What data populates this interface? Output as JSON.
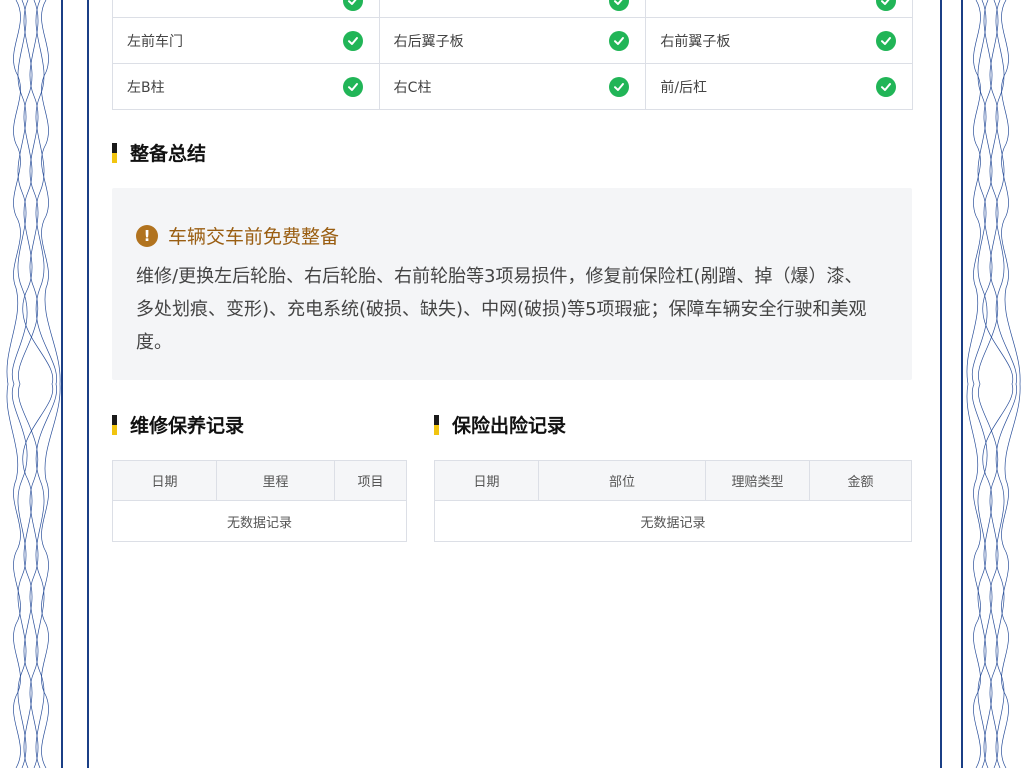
{
  "inspection": {
    "rows": [
      {
        "cells": [
          {
            "label": "左前车门",
            "status": "ok"
          },
          {
            "label": "右后翼子板",
            "status": "ok"
          },
          {
            "label": "右前翼子板",
            "status": "ok"
          }
        ]
      },
      {
        "cells": [
          {
            "label": "左B柱",
            "status": "ok"
          },
          {
            "label": "右C柱",
            "status": "ok"
          },
          {
            "label": "前/后杠",
            "status": "ok"
          }
        ]
      }
    ],
    "status_color": "#21b557"
  },
  "summary": {
    "heading": "整备总结",
    "title": "车辆交车前免费整备",
    "text": "维修/更换左后轮胎、右后轮胎、右前轮胎等3项易损件，修复前保险杠(剐蹭、掉（爆）漆、多处划痕、变形)、充电系统(破损、缺失)、中网(破损)等5项瑕疵；保障车辆安全行驶和美观度。",
    "icon": "warning-icon"
  },
  "maintenance": {
    "heading": "维修保养记录",
    "columns": [
      "日期",
      "里程",
      "项目"
    ],
    "empty_text": "无数据记录"
  },
  "insurance": {
    "heading": "保险出险记录",
    "columns": [
      "日期",
      "部位",
      "理赔类型",
      "金额"
    ],
    "empty_text": "无数据记录"
  },
  "colors": {
    "frame": "#1b3f86",
    "accent_yellow": "#f1c40f",
    "warning": "#b1731f"
  }
}
